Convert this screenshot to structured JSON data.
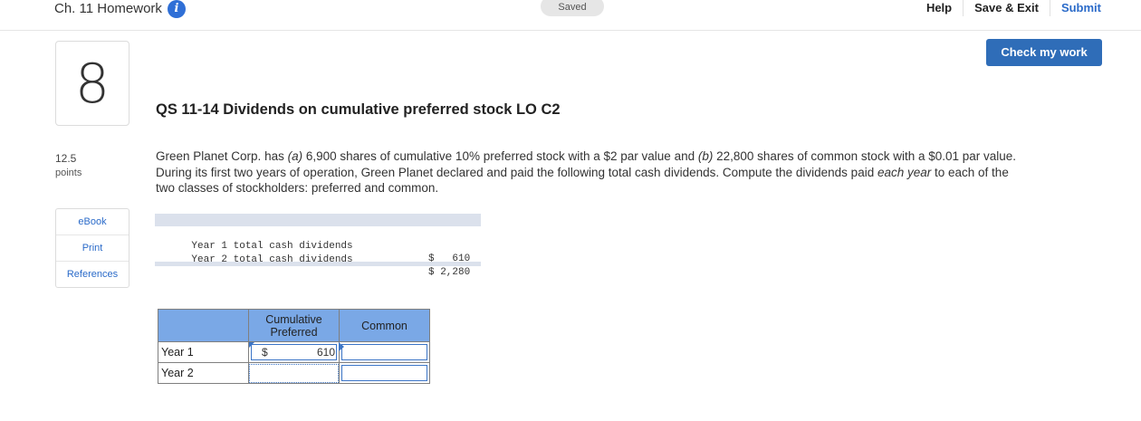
{
  "header": {
    "title": "Ch. 11 Homework",
    "info_icon": "i",
    "saved": "Saved",
    "help": "Help",
    "save_exit": "Save & Exit",
    "submit": "Submit",
    "check_work": "Check my work"
  },
  "question": {
    "number": "8",
    "points_value": "12.5",
    "points_label": "points",
    "title": "QS 11-14 Dividends on cumulative preferred stock LO C2",
    "text_parts": {
      "p1": "Green Planet Corp. has ",
      "a": "(a)",
      "p2": " 6,900 shares of cumulative 10% preferred stock with a $2 par value and ",
      "b": "(b)",
      "p3": " 22,800 shares of common stock with a $0.01 par value. During its first two years of operation, Green Planet declared and paid the following total cash dividends. Compute the dividends paid ",
      "each_year": "each year",
      "p4": " to each of the two classes of stockholders: preferred and common."
    }
  },
  "resources": {
    "ebook": "eBook",
    "print": "Print",
    "references": "References"
  },
  "given": {
    "rows": [
      {
        "label": "Year 1 total cash dividends",
        "amount": "$   610"
      },
      {
        "label": "Year 2 total cash dividends",
        "amount": "$ 2,280"
      }
    ]
  },
  "answer_table": {
    "headers": {
      "pref": "Cumulative Preferred",
      "common": "Common"
    },
    "rows": [
      {
        "label": "Year 1",
        "pref_dollar": "$",
        "pref_value": "610",
        "common_value": ""
      },
      {
        "label": "Year 2",
        "pref_dollar": "",
        "pref_value": "",
        "common_value": ""
      }
    ]
  },
  "colors": {
    "accent": "#2f6db8",
    "link": "#2b6bc9",
    "table_header": "#7aa8e6",
    "given_band": "#dbe1ec"
  }
}
